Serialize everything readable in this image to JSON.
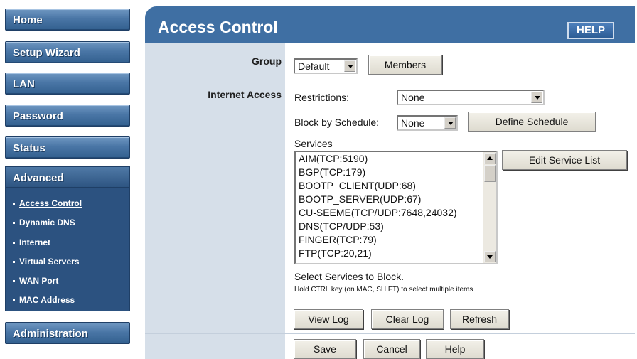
{
  "sidebar": {
    "nav": [
      {
        "label": "Home"
      },
      {
        "label": "Setup Wizard"
      },
      {
        "label": "LAN"
      },
      {
        "label": "Password"
      },
      {
        "label": "Status"
      }
    ],
    "advanced": {
      "label": "Advanced",
      "items": [
        {
          "label": "Access Control"
        },
        {
          "label": "Dynamic DNS"
        },
        {
          "label": "Internet"
        },
        {
          "label": "Virtual Servers"
        },
        {
          "label": "WAN Port"
        },
        {
          "label": "MAC Address"
        }
      ]
    },
    "administration": {
      "label": "Administration"
    }
  },
  "header": {
    "title": "Access Control",
    "help_label": "HELP"
  },
  "form": {
    "group": {
      "label": "Group",
      "value": "Default",
      "members_label": "Members"
    },
    "internet_access": {
      "label": "Internet Access",
      "restrictions_label": "Restrictions:",
      "restrictions_value": "None",
      "schedule_label": "Block by Schedule:",
      "schedule_value": "None",
      "define_schedule_label": "Define Schedule",
      "services_label": "Services",
      "services": [
        "AIM(TCP:5190)",
        "BGP(TCP:179)",
        "BOOTP_CLIENT(UDP:68)",
        "BOOTP_SERVER(UDP:67)",
        "CU-SEEME(TCP/UDP:7648,24032)",
        "DNS(TCP/UDP:53)",
        "FINGER(TCP:79)",
        "FTP(TCP:20,21)"
      ],
      "edit_service_list_label": "Edit Service List",
      "select_hint": "Select Services to Block.",
      "ctrl_hint": "Hold CTRL key (on MAC, SHIFT) to select multiple items"
    },
    "log_buttons": {
      "view_log": "View Log",
      "clear_log": "Clear Log",
      "refresh": "Refresh"
    },
    "footer_buttons": {
      "save": "Save",
      "cancel": "Cancel",
      "help": "Help"
    }
  }
}
